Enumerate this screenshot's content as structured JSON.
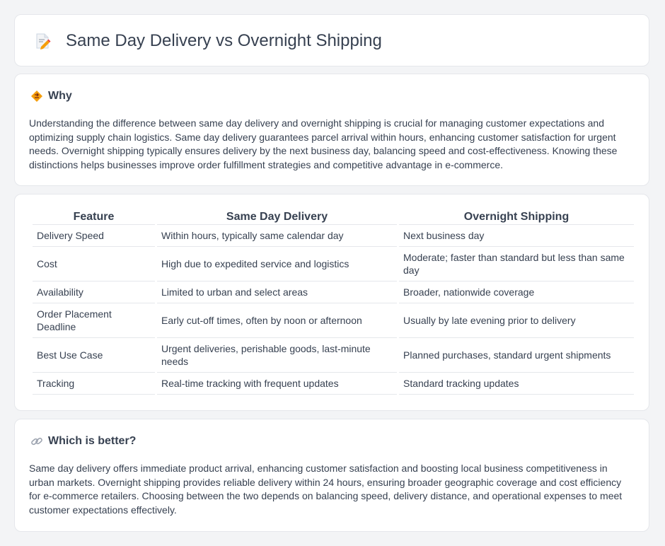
{
  "header": {
    "title": "Same Day Delivery vs Overnight Shipping",
    "icon": "document-pencil-icon"
  },
  "why": {
    "heading": "Why",
    "icon": "diamond-warning-icon",
    "text": "Understanding the difference between same day delivery and overnight shipping is crucial for managing customer expectations and optimizing supply chain logistics. Same day delivery guarantees parcel arrival within hours, enhancing customer satisfaction for urgent needs. Overnight shipping typically ensures delivery by the next business day, balancing speed and cost-effectiveness. Knowing these distinctions helps businesses improve order fulfillment strategies and competitive advantage in e-commerce."
  },
  "table": {
    "headers": [
      "Feature",
      "Same Day Delivery",
      "Overnight Shipping"
    ],
    "rows": [
      [
        "Delivery Speed",
        "Within hours, typically same calendar day",
        "Next business day"
      ],
      [
        "Cost",
        "High due to expedited service and logistics",
        "Moderate; faster than standard but less than same day"
      ],
      [
        "Availability",
        "Limited to urban and select areas",
        "Broader, nationwide coverage"
      ],
      [
        "Order Placement Deadline",
        "Early cut-off times, often by noon or afternoon",
        "Usually by late evening prior to delivery"
      ],
      [
        "Best Use Case",
        "Urgent deliveries, perishable goods, last-minute needs",
        "Planned purchases, standard urgent shipments"
      ],
      [
        "Tracking",
        "Real-time tracking with frequent updates",
        "Standard tracking updates"
      ]
    ]
  },
  "better": {
    "heading": "Which is better?",
    "icon": "link-icon",
    "text": "Same day delivery offers immediate product arrival, enhancing customer satisfaction and boosting local business competitiveness in urban markets. Overnight shipping provides reliable delivery within 24 hours, ensuring broader geographic coverage and cost efficiency for e-commerce retailers. Choosing between the two depends on balancing speed, delivery distance, and operational expenses to meet customer expectations effectively."
  }
}
